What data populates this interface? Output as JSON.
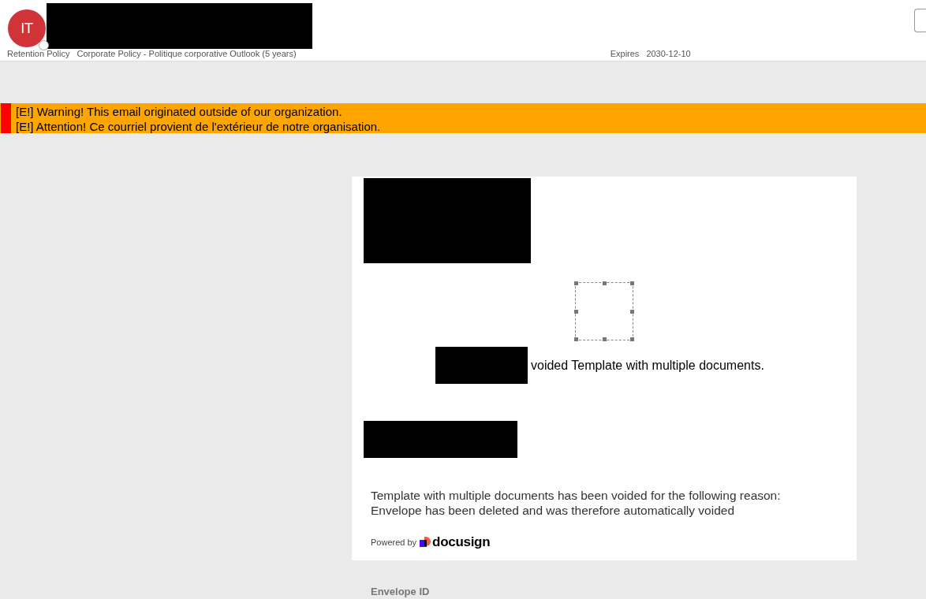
{
  "header": {
    "avatar_initials": "IT",
    "retention_label": "Retention Policy",
    "retention_value": "Corporate Policy - Politique corporative Outlook (5 years)",
    "expires_label": "Expires",
    "expires_value": "2030-12-10"
  },
  "warning": {
    "lines": [
      "[E!] Warning! This email originated outside of our organization.",
      "[E!] Attention! Ce courriel provient de l'extérieur de notre organisation."
    ]
  },
  "card": {
    "voided_text": "voided Template with multiple documents.",
    "reason_lines": [
      "Template with multiple documents has been voided for the following reason:",
      "Envelope has been deleted and was therefore automatically voided"
    ],
    "powered_by": "Powered by",
    "brand": "docusign"
  },
  "footer": {
    "envelope_id_label": "Envelope ID"
  }
}
